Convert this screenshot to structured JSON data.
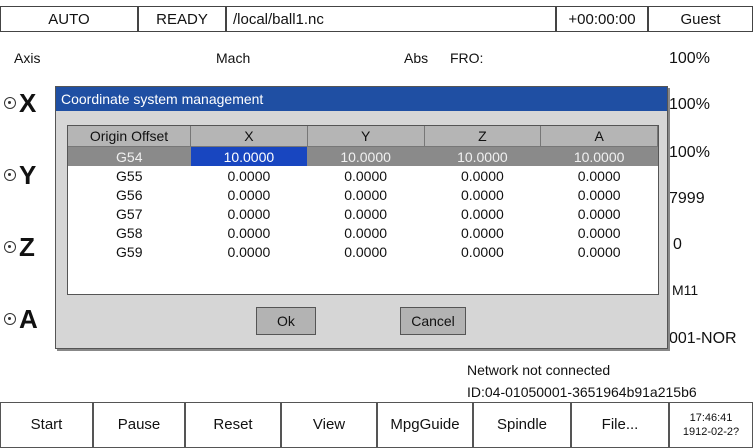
{
  "topbar": {
    "mode": "AUTO",
    "state": "READY",
    "file": "/local/ball1.nc",
    "timer": "+00:00:00",
    "user": "Guest"
  },
  "header": {
    "axis": "Axis",
    "mach": "Mach",
    "abs": "Abs",
    "fro": "FRO:"
  },
  "axes": [
    "X",
    "Y",
    "Z",
    "A"
  ],
  "right_values": [
    "100%",
    "100%",
    "100%",
    "7999",
    "0",
    "M11",
    "001-NOR"
  ],
  "network": "Network not connected",
  "device_id": "ID:04-01050001-3651964b91a215b6",
  "dialog": {
    "title": "Coordinate system management",
    "columns": [
      "Origin Offset",
      "X",
      "Y",
      "Z",
      "A"
    ],
    "rows": [
      {
        "name": "G54",
        "x": "10.0000",
        "y": "10.0000",
        "z": "10.0000",
        "a": "10.0000"
      },
      {
        "name": "G55",
        "x": "0.0000",
        "y": "0.0000",
        "z": "0.0000",
        "a": "0.0000"
      },
      {
        "name": "G56",
        "x": "0.0000",
        "y": "0.0000",
        "z": "0.0000",
        "a": "0.0000"
      },
      {
        "name": "G57",
        "x": "0.0000",
        "y": "0.0000",
        "z": "0.0000",
        "a": "0.0000"
      },
      {
        "name": "G58",
        "x": "0.0000",
        "y": "0.0000",
        "z": "0.0000",
        "a": "0.0000"
      },
      {
        "name": "G59",
        "x": "0.0000",
        "y": "0.0000",
        "z": "0.0000",
        "a": "0.0000"
      }
    ],
    "ok_label": "Ok",
    "cancel_label": "Cancel"
  },
  "softkeys": [
    "Start",
    "Pause",
    "Reset",
    "View",
    "MpgGuide",
    "Spindle",
    "File..."
  ],
  "clock": {
    "time": "17:46:41",
    "date": "1912-02-2?"
  }
}
